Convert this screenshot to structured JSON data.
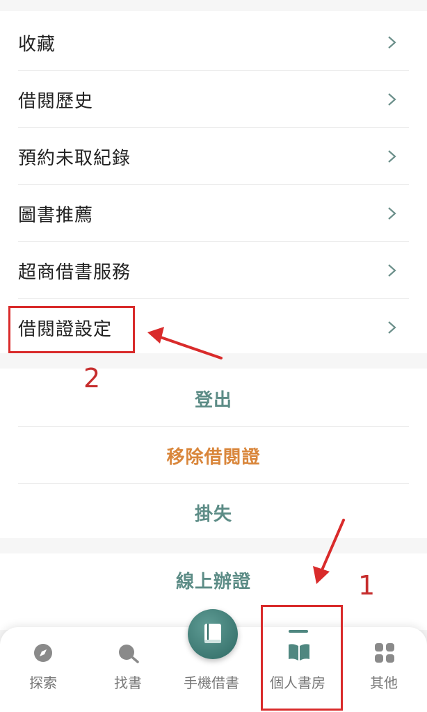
{
  "menu": {
    "items": [
      {
        "label": "收藏"
      },
      {
        "label": "借閱歷史"
      },
      {
        "label": "預約未取紀錄"
      },
      {
        "label": "圖書推薦"
      },
      {
        "label": "超商借書服務"
      },
      {
        "label": "借閱證設定"
      }
    ]
  },
  "actions": {
    "logout": "登出",
    "remove_card": "移除借閱證",
    "report_lost": "掛失",
    "online_apply": "線上辦證"
  },
  "tabbar": {
    "explore": "探索",
    "find_books": "找書",
    "mobile_borrow": "手機借書",
    "my_shelf": "個人書房",
    "other": "其他"
  },
  "annotations": {
    "step1": "1",
    "step2": "2"
  },
  "colors": {
    "teal": "#5c8c86",
    "orange": "#d9863b",
    "annotation_red": "#d92b2b"
  }
}
